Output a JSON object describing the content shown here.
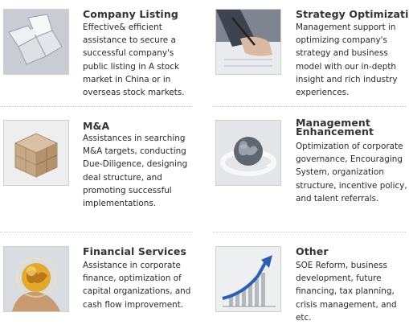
{
  "services": [
    {
      "title": "Company Listing",
      "icon": "puzzle-icon",
      "lines": [
        "Effective& efficient",
        "assistance to secure a",
        "successful company's",
        "public listing in A stock",
        "market in China or in",
        "overseas stock markets."
      ]
    },
    {
      "title": "Strategy Optimization",
      "icon": "pen-writing-icon",
      "lines": [
        "Management support in",
        "optimizing company's",
        "strategy and business",
        "model with our in-depth",
        "insight and rich industry",
        "experiences."
      ]
    },
    {
      "title": "M&A",
      "icon": "cube-blocks-icon",
      "lines": [
        "Assistances in searching",
        "M&A targets, conducting",
        "Due-Diligence, designing",
        "deal structure, and",
        "promoting successful",
        "implementations."
      ]
    },
    {
      "title_lines": [
        "Management",
        "Enhancement"
      ],
      "icon": "globe-arrows-icon",
      "lines": [
        "Optimization of corporate",
        "governance, Encouraging",
        "System, organization",
        "structure, incentive policy,",
        "and talent referrals."
      ]
    },
    {
      "title": "Financial Services",
      "icon": "golden-globe-hand-icon",
      "lines": [
        "Assistance in corporate",
        "finance, optimization of",
        "capital organizations, and",
        "cash flow improvement."
      ]
    },
    {
      "title": "Other",
      "icon": "growth-chart-icon",
      "lines": [
        "SOE Reform, business",
        "development, future",
        "financing, tax planning,",
        "crisis management, and",
        "etc."
      ]
    }
  ]
}
